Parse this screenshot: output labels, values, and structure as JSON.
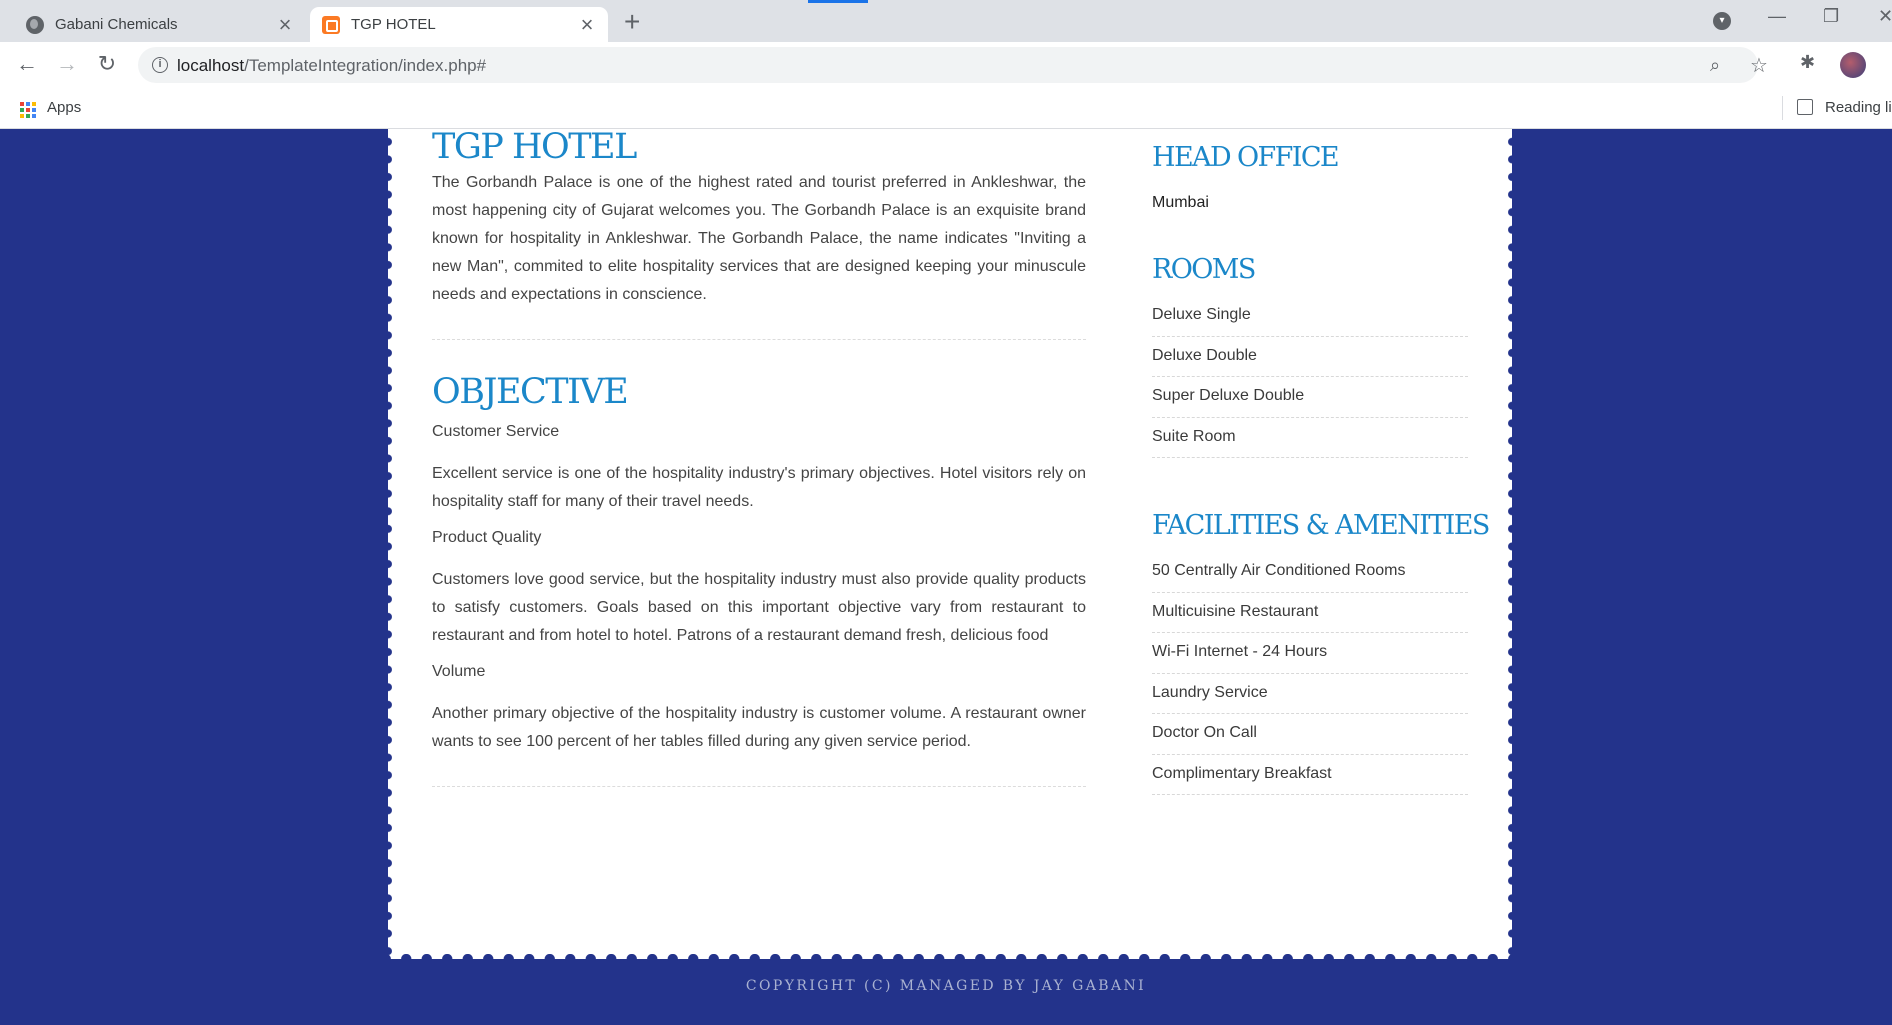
{
  "browser": {
    "tabs": [
      {
        "title": "Gabani Chemicals",
        "active": false,
        "icon": "globe-icon"
      },
      {
        "title": "TGP HOTEL",
        "active": true,
        "icon": "xampp-icon"
      }
    ],
    "url_host": "localhost",
    "url_path": "/TemplateIntegration/index.php#",
    "bookmarks": {
      "apps_label": "Apps",
      "reading_list_label": "Reading list"
    }
  },
  "about": {
    "title": "TGP HOTEL",
    "text": "The Gorbandh Palace is one of the highest rated and tourist preferred in Ankleshwar, the most happening city of Gujarat welcomes you. The Gorbandh Palace is an exquisite brand known for hospitality in Ankleshwar. The Gorbandh Palace, the name indicates \"Inviting a new Man\", commited to elite hospitality services that are designed keeping your minuscule needs and expectations in conscience."
  },
  "objective": {
    "title": "OBJECTIVE",
    "items": [
      {
        "heading": "Customer Service",
        "text": "Excellent service is one of the hospitality industry's primary objectives. Hotel visitors rely on hospitality staff for many of their travel needs."
      },
      {
        "heading": "Product Quality",
        "text": "Customers love good service, but the hospitality industry must also provide quality products to satisfy customers. Goals based on this important objective vary from restaurant to restaurant and from hotel to hotel. Patrons of a restaurant demand fresh, delicious food"
      },
      {
        "heading": "Volume",
        "text": "Another primary objective of the hospitality industry is customer volume. A restaurant owner wants to see 100 percent of her tables filled during any given service period."
      }
    ]
  },
  "head_office": {
    "title": "HEAD OFFICE",
    "city": "Mumbai"
  },
  "rooms": {
    "title": "ROOMS",
    "items": [
      "Deluxe Single",
      "Deluxe Double",
      "Super Deluxe Double",
      "Suite Room"
    ]
  },
  "facilities": {
    "title": "FACILITIES & AMENITIES",
    "items": [
      "50 Centrally Air Conditioned Rooms",
      "Multicuisine Restaurant",
      "Wi-Fi Internet - 24 Hours",
      "Laundry Service",
      "Doctor On Call",
      "Complimentary Breakfast"
    ]
  },
  "footer": {
    "text": "COPYRIGHT (C) MANAGED BY JAY GABANI"
  },
  "colors": {
    "page_bg": "#23338b",
    "heading": "#1b87c9",
    "footer_text": "#a9b1d1"
  }
}
